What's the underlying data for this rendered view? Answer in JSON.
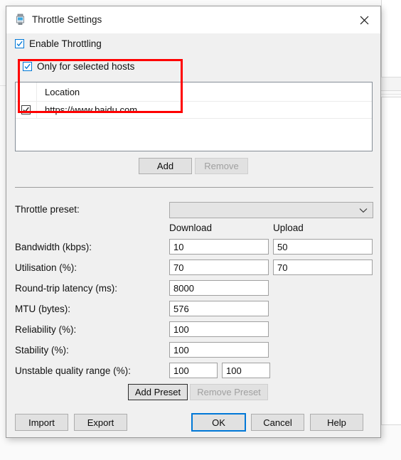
{
  "window": {
    "title": "Throttle Settings",
    "icon": "throttle-icon",
    "close_icon": "close-icon"
  },
  "options": {
    "enable_throttling": {
      "label": "Enable Throttling",
      "checked": true
    },
    "only_selected_hosts": {
      "label": "Only for selected hosts",
      "checked": true
    }
  },
  "host_list": {
    "columns": [
      "",
      "Location"
    ],
    "rows": [
      {
        "checked": true,
        "location": "https://www.baidu.com"
      }
    ]
  },
  "list_buttons": {
    "add": {
      "label": "Add",
      "enabled": true
    },
    "remove": {
      "label": "Remove",
      "enabled": false
    }
  },
  "preset": {
    "label": "Throttle preset:",
    "value": "",
    "chevron_icon": "chevron-down-icon"
  },
  "columns": {
    "download": "Download",
    "upload": "Upload"
  },
  "fields": [
    {
      "label": "Bandwidth (kbps):",
      "download": "10",
      "upload": "50"
    },
    {
      "label": "Utilisation (%):",
      "download": "70",
      "upload": "70"
    },
    {
      "label": "Round-trip latency (ms):",
      "download": "8000",
      "upload": null
    },
    {
      "label": "MTU (bytes):",
      "download": "576",
      "upload": null
    },
    {
      "label": "Reliability (%):",
      "download": "100",
      "upload": null
    },
    {
      "label": "Stability (%):",
      "download": "100",
      "upload": null
    }
  ],
  "unstable_range": {
    "label": "Unstable quality range (%):",
    "min": "100",
    "max": "100"
  },
  "preset_buttons": {
    "add_preset": {
      "label": "Add Preset",
      "enabled": true
    },
    "remove_preset": {
      "label": "Remove Preset",
      "enabled": false
    }
  },
  "footer_buttons": {
    "import": {
      "label": "Import"
    },
    "export": {
      "label": "Export"
    },
    "ok": {
      "label": "OK",
      "focused": true
    },
    "cancel": {
      "label": "Cancel"
    },
    "help": {
      "label": "Help"
    }
  },
  "colors": {
    "accent": "#0078d7",
    "annotation": "#ff0000",
    "dialog_bg": "#f0f0f0",
    "titlebar_bg": "#ffffff"
  },
  "annotation": {
    "name": "highlight-rectangle"
  }
}
